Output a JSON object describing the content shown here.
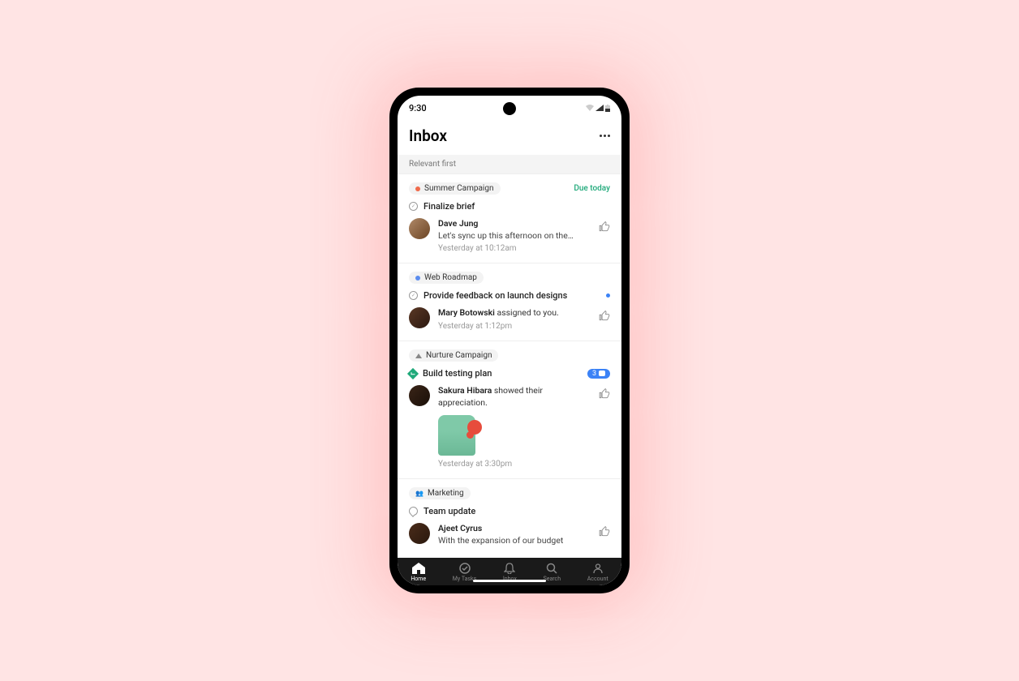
{
  "status": {
    "time": "9:30"
  },
  "header": {
    "title": "Inbox"
  },
  "sort": {
    "label": "Relevant first"
  },
  "cards": [
    {
      "chip_label": "Summer Campaign",
      "chip_color": "#f06a4b",
      "due": "Due today",
      "task": "Finalize brief",
      "author": "Dave Jung",
      "suffix": "",
      "message": "Let's sync up this afternoon on the…",
      "time": "Yesterday at 10:12am"
    },
    {
      "chip_label": "Web Roadmap",
      "chip_color": "#5b8def",
      "task": "Provide feedback on launch designs",
      "author": "Mary Botowski",
      "suffix": " assigned to you.",
      "time": "Yesterday at 1:12pm"
    },
    {
      "chip_label": "Nurture Campaign",
      "task": "Build testing plan",
      "comment_count": "3",
      "author": "Sakura Hibara",
      "suffix": " showed their appreciation.",
      "time": "Yesterday at 3:30pm"
    },
    {
      "chip_label": "Marketing",
      "task": "Team update",
      "author": "Ajeet Cyrus",
      "message": "With the expansion of our budget"
    }
  ],
  "tabs": [
    {
      "label": "Home"
    },
    {
      "label": "My Tasks"
    },
    {
      "label": "Inbox"
    },
    {
      "label": "Search"
    },
    {
      "label": "Account"
    }
  ]
}
